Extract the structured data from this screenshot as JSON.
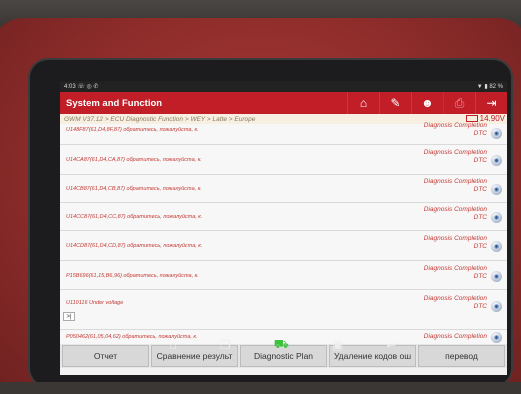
{
  "status_bar": {
    "time": "4:03 ☏ ◎ ✆",
    "battery": "▼ ▮ 82 %"
  },
  "header": {
    "title": "System and Function"
  },
  "toolbar_icons": [
    "home-icon",
    "edit-icon",
    "user-icon",
    "print-icon",
    "exit-icon"
  ],
  "breadcrumb": "GWM V37.12 > ECU Diagnostic Function > WEY > Latte > Europe",
  "voltage": "14.90V",
  "rows": [
    {
      "code": "U148F87(61,D4,8F,87) обратитесь, пожалуйста, к.",
      "status": "Diagnosis Completion\nDTC"
    },
    {
      "code": "U14CA87(61,D4,CA,87) обратитесь, пожалуйста, к.",
      "status": "Diagnosis Completion\nDTC"
    },
    {
      "code": "U14CB87(61,D4,CB,87) обратитесь, пожалуйста, к.",
      "status": "Diagnosis Completion\nDTC"
    },
    {
      "code": "U14CC87(61,D4,CC,87) обратитесь, пожалуйста, к.",
      "status": "Diagnosis Completion\nDTC"
    },
    {
      "code": "U14CD87(61,D4,CD,87) обратитесь, пожалуйста, к.",
      "status": "Diagnosis Completion\nDTC"
    },
    {
      "code": "P15B696(61,15,B6,96) обратитесь, пожалуйста, к.",
      "status": "Diagnosis Completion\nDTC"
    },
    {
      "code": "U110116 Under voltage",
      "status": "Diagnosis Completion\nDTC"
    },
    {
      "code": "P050462(61,05,04,62) обратитесь, пожалуйста, к.",
      "status": "Diagnosis Completion"
    }
  ],
  "collapse_label": ">|",
  "buttons": [
    "Отчет",
    "Сравнение результ",
    "Diagnostic Plan",
    "Удаление кодов ош",
    "перевод"
  ],
  "system_nav": [
    "back-home-icon",
    "recent-apps-icon",
    "car-icon",
    "screenshot-icon",
    "return-icon"
  ]
}
